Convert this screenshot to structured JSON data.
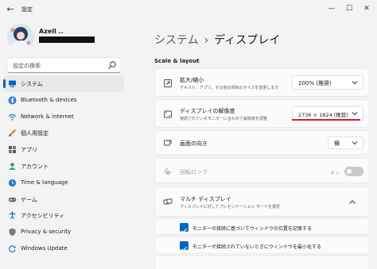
{
  "window": {
    "title": "設定"
  },
  "profile": {
    "name": "Azell .."
  },
  "search": {
    "placeholder": "設定の検索"
  },
  "sidebar": {
    "items": [
      {
        "label": "システム",
        "icon": "monitor-icon",
        "active": true
      },
      {
        "label": "Bluetooth & devices",
        "icon": "bluetooth-icon"
      },
      {
        "label": "Network & internet",
        "icon": "wifi-icon"
      },
      {
        "label": "個人用設定",
        "icon": "brush-icon"
      },
      {
        "label": "アプリ",
        "icon": "apps-icon"
      },
      {
        "label": "アカウント",
        "icon": "person-icon"
      },
      {
        "label": "Time & language",
        "icon": "clock-globe-icon"
      },
      {
        "label": "ゲーム",
        "icon": "gamepad-icon"
      },
      {
        "label": "アクセシビリティ",
        "icon": "accessibility-icon"
      },
      {
        "label": "Privacy & security",
        "icon": "shield-icon"
      },
      {
        "label": "Windows Update",
        "icon": "update-icon"
      }
    ]
  },
  "breadcrumb": {
    "parent": "システム",
    "separator": "›",
    "current": "ディスプレイ"
  },
  "section": {
    "title": "Scale & layout"
  },
  "scale": {
    "title": "拡大/縮小",
    "description": "テキスト、アプリ、その他の項目のサイズを変更します",
    "value": "200% (推奨)"
  },
  "resolution": {
    "title": "ディスプレイの解像度",
    "description": "接続されているモニターに合わせて解像度を調整",
    "value": "2736 × 1824 (推奨)"
  },
  "orientation": {
    "title": "画面の向き",
    "value": "横"
  },
  "rotation_lock": {
    "title": "回転ロック",
    "state_label": "オン",
    "enabled": false
  },
  "multi_display": {
    "title": "マルチ ディスプレイ",
    "description": "ディスプレイに対してプレゼンテーション モードを選択",
    "options": [
      {
        "label": "モニターの接続に基づいてウィンドウの位置を記憶する",
        "checked": true
      },
      {
        "label": "モニターが接続されていないときにウィンドウを最小化する",
        "checked": true
      }
    ]
  },
  "colors": {
    "accent": "#0067c0",
    "highlight": "#e0182d"
  }
}
